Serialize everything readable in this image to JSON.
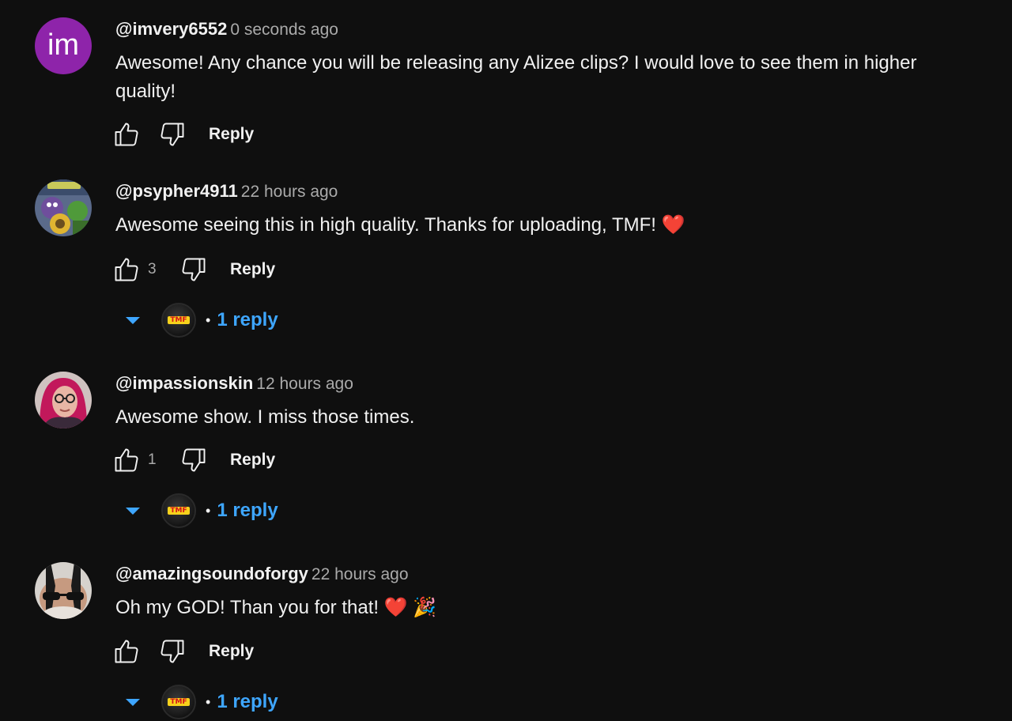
{
  "comments": [
    {
      "avatar_letter": "im",
      "avatar_color": "#8e24aa",
      "author": "@imvery6552",
      "time": "0 seconds ago",
      "text": "Awesome! Any chance you will be releasing any Alizee clips? I would love to see them in higher quality!",
      "likes": "",
      "reply_label": "Reply",
      "replies": ""
    },
    {
      "avatar_letter": "",
      "author": "@psypher4911",
      "time": "22 hours ago",
      "text": "Awesome seeing this in high quality. Thanks for uploading, TMF! ❤️",
      "likes": "3",
      "reply_label": "Reply",
      "replies": "1 reply"
    },
    {
      "avatar_letter": "",
      "author": "@impassionskin",
      "time": "12 hours ago",
      "text": "Awesome show. I miss those times.",
      "likes": "1",
      "reply_label": "Reply",
      "replies": "1 reply"
    },
    {
      "avatar_letter": "",
      "author": "@amazingsoundoforgy",
      "time": "22 hours ago",
      "text": "Oh my GOD! Than you for that! ❤️ 🎉",
      "likes": "",
      "reply_label": "Reply",
      "replies": "1 reply"
    }
  ],
  "reply_avatar_label": "TMF",
  "separator": "•",
  "colors": {
    "background": "#0f0f0f",
    "link_blue": "#3ea6ff",
    "secondary_text": "#aaaaaa"
  }
}
